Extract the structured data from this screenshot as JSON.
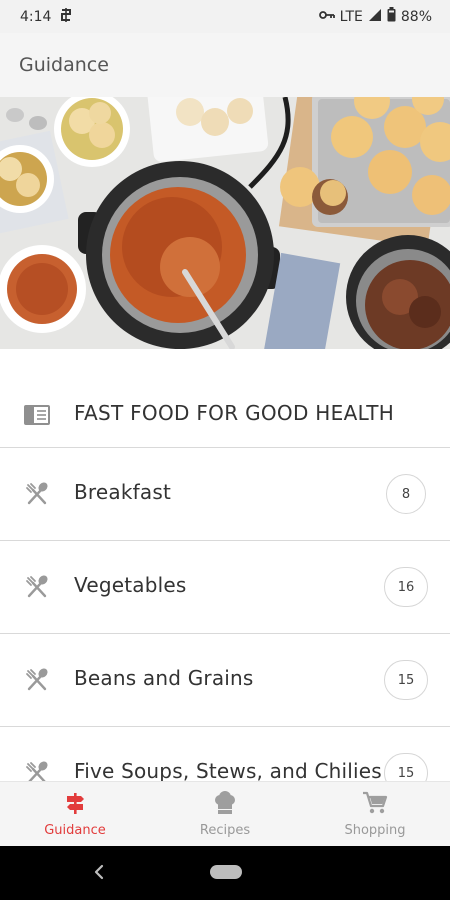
{
  "status_bar": {
    "time": "4:14",
    "network": "LTE",
    "battery": "88%"
  },
  "app_bar": {
    "title": "Guidance"
  },
  "list": {
    "header": {
      "title": "FAST FOOD FOR GOOD HEALTH"
    },
    "items": [
      {
        "label": "Breakfast",
        "count": "8"
      },
      {
        "label": "Vegetables",
        "count": "16"
      },
      {
        "label": "Beans and Grains",
        "count": "15"
      },
      {
        "label": "Five Soups, Stews, and Chilies",
        "count": "15"
      }
    ]
  },
  "bottom_nav": {
    "items": [
      {
        "label": "Guidance",
        "icon": "signpost-icon",
        "active": true
      },
      {
        "label": "Recipes",
        "icon": "chef-hat-icon",
        "active": false
      },
      {
        "label": "Shopping",
        "icon": "cart-icon",
        "active": false
      }
    ]
  },
  "colors": {
    "accent": "#e23c3c",
    "inactive": "#999999",
    "divider": "#d9d9d9"
  }
}
